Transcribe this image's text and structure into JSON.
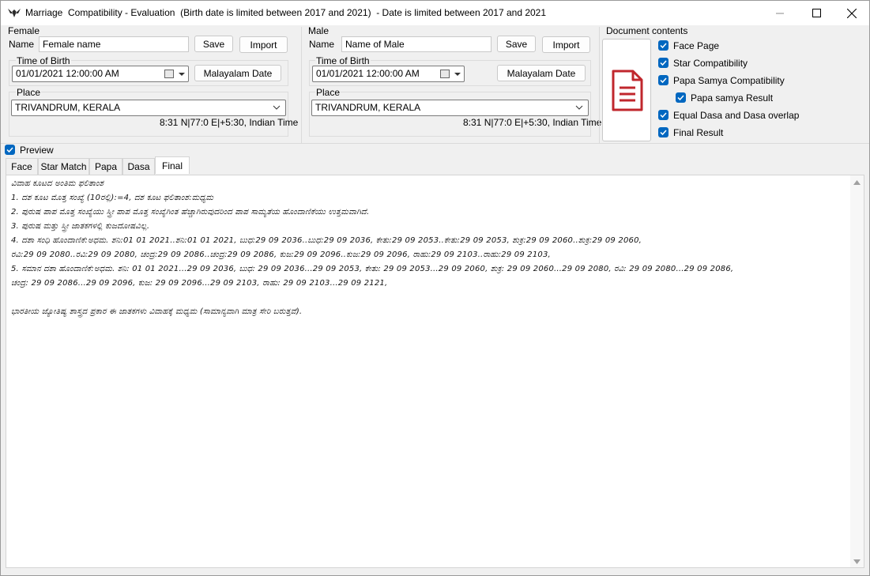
{
  "window": {
    "title": "Marriage  Compatibility - Evaluation  (Birth date is limited between 2017 and 2021)  - Date is limited between 2017 and 2021"
  },
  "female": {
    "section_label": "Female",
    "name_label": "Name",
    "name_value": "Female name",
    "save_label": "Save",
    "import_label": "Import",
    "time_group_label": "Time of Birth",
    "datetime_value": "01/01/2021  12:00:00 AM",
    "malayalam_label": "Malayalam Date",
    "place_group_label": "Place",
    "place_value": "TRIVANDRUM, KERALA",
    "coords": "8:31 N|77:0 E|+5:30, Indian Time"
  },
  "male": {
    "section_label": "Male",
    "name_label": "Name",
    "name_value": "Name of Male",
    "save_label": "Save",
    "import_label": "Import",
    "time_group_label": "Time of Birth",
    "datetime_value": "01/01/2021  12:00:00 AM",
    "malayalam_label": "Malayalam Date",
    "place_group_label": "Place",
    "place_value": "TRIVANDRUM, KERALA",
    "coords": "8:31 N|77:0 E|+5:30, Indian Time"
  },
  "document_contents": {
    "label": "Document contents",
    "items": [
      {
        "label": "Face Page",
        "checked": true
      },
      {
        "label": "Star Compatibility",
        "checked": true
      },
      {
        "label": "Papa Samya Compatibility",
        "checked": true
      },
      {
        "label": "Papa samya Result",
        "checked": true
      },
      {
        "label": "Equal Dasa and Dasa overlap",
        "checked": true
      },
      {
        "label": "Final Result",
        "checked": true
      }
    ]
  },
  "preview": {
    "label": "Preview",
    "checked": true
  },
  "tabs": [
    {
      "label": "Face"
    },
    {
      "label": "Star Match"
    },
    {
      "label": "Papa"
    },
    {
      "label": "Dasa"
    },
    {
      "label": "Final",
      "active": true
    }
  ],
  "result_lines": [
    "ವಿವಾಹ ಕೂಟದ ಅಂತಿಮ ಫಲಿತಾಂಶ",
    "1. ದಶ ಕೂಟ ಮೊತ್ತ ಸಂಖ್ಯೆ (10ರಲ್ಲಿ):=4, ದಶ ಕೂಟ ಫಲಿತಾಂಶ:ಮಧ್ಯಮ",
    "2. ಪುರುಷ ಪಾಪ ಮೊತ್ತ ಸಂಖ್ಯೆಯು ಸ್ತ್ರೀ ಪಾಪ ಮೊತ್ತ ಸಂಖ್ಯೆಗಿಂತ ಹೆಚ್ಚಾಗಿರುವುದರಿಂದ ಪಾಪ ಸಾಮ್ಯತೆಯ ಹೊಂದಾಣಿಕೆಯು ಉತ್ತಮವಾಗಿದೆ.",
    "3. ಪುರುಷ ಮತ್ತು ಸ್ತ್ರೀ ಜಾತಕಗಳಲ್ಲಿ ಕುಜದೋಷವಿಲ್ಲ.",
    "4. ದಶಾ ಸಂಧಿ ಹೊಂದಾಣಿಕೆ:ಅಧಮ. ಶನಿ:01   01   2021..ಶನಿ:01   01   2021, ಬುಧ:29   09   2036..ಬುಧ:29   09   2036, ಕೇತು:29   09   2053..ಕೇತು:29   09   2053, ಶುಕ್ರ:29   09   2060..ಶುಕ್ರ:29   09   2060,",
    "ರವಿ:29   09   2080..ರವಿ:29   09   2080, ಚಂದ್ರ:29   09   2086..ಚಂದ್ರ:29   09   2086, ಕುಜ:29   09   2096..ಕುಜ:29   09   2096, ರಾಹು:29   09   2103..ರಾಹು:29   09   2103,",
    "5. ಸಮಾನ ದಶಾ ಹೊಂದಾಣಿಕೆ:ಅಧಮ. ಶನಿ: 01   01   2021...29   09   2036, ಬುಧ: 29   09   2036...29   09   2053, ಕೇತು: 29   09   2053...29   09   2060, ಶುಕ್ರ: 29   09   2060...29   09   2080, ರವಿ: 29   09   2080...29   09   2086,",
    "ಚಂದ್ರ: 29   09   2086...29   09   2096, ಕುಜ: 29   09   2096...29   09   2103, ರಾಹು: 29   09   2103...29   09   2121,",
    "",
    "ಭಾರತೀಯ ಜ್ಯೋತಿಷ್ಯ ಶಾಸ್ತ್ರದ ಪ್ರಕಾರ ಈ ಜಾತಕಗಳು ವಿವಾಹಕ್ಕೆ ಮಧ್ಯಮ (ಸಾಮಾನ್ಯವಾಗಿ ಮಾತ್ರ ಸೇರಿ ಬರುತ್ತವೆ)."
  ],
  "icons": {
    "app": "eagle-icon",
    "document": "document-icon"
  },
  "colors": {
    "accent": "#0067c0",
    "document_icon": "#c0272d"
  }
}
